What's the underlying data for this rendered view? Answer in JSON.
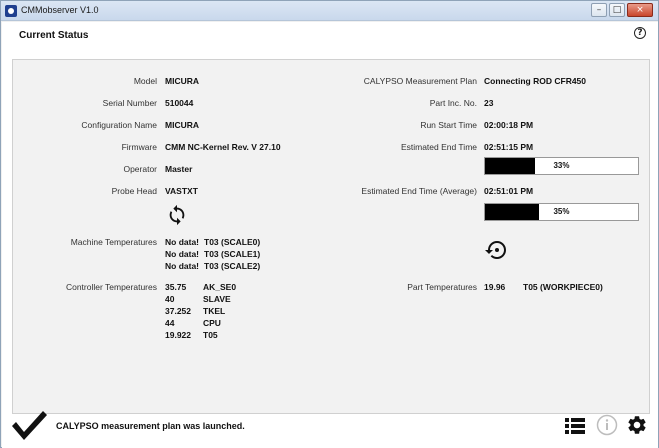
{
  "window": {
    "title": "CMMobserver V1.0",
    "minimize": "–",
    "maximize": "□",
    "close": "×"
  },
  "header": {
    "title": "Current Status",
    "help": "?"
  },
  "left": {
    "model": {
      "label": "Model",
      "value": "MICURA"
    },
    "serial": {
      "label": "Serial Number",
      "value": "510044"
    },
    "config": {
      "label": "Configuration Name",
      "value": "MICURA"
    },
    "firmware": {
      "label": "Firmware",
      "value": "CMM NC-Kernel Rev. V 27.10"
    },
    "operator": {
      "label": "Operator",
      "value": "Master"
    },
    "probe": {
      "label": "Probe Head",
      "value": "VASTXT"
    },
    "machine_temps": {
      "label": "Machine Temperatures",
      "rows": [
        {
          "value": "No data!",
          "sensor": "T03 (SCALE0)"
        },
        {
          "value": "No data!",
          "sensor": "T03 (SCALE1)"
        },
        {
          "value": "No data!",
          "sensor": "T03 (SCALE2)"
        }
      ]
    },
    "controller_temps": {
      "label": "Controller Temperatures",
      "rows": [
        {
          "value": "35.75",
          "sensor": "AK_SE0"
        },
        {
          "value": "40",
          "sensor": "SLAVE"
        },
        {
          "value": "37.252",
          "sensor": "TKEL"
        },
        {
          "value": "44",
          "sensor": "CPU"
        },
        {
          "value": "19.922",
          "sensor": "T05"
        }
      ]
    }
  },
  "right": {
    "plan": {
      "label": "CALYPSO Measurement Plan",
      "value": "Connecting ROD CFR450"
    },
    "part_inc": {
      "label": "Part Inc. No.",
      "value": "23"
    },
    "run_start": {
      "label": "Run Start Time",
      "value": "02:00:18 PM"
    },
    "est_end": {
      "label": "Estimated End Time",
      "value": "02:51:15 PM",
      "progress": 33,
      "progress_text": "33%"
    },
    "est_end_avg": {
      "label": "Estimated End Time (Average)",
      "value": "02:51:01 PM",
      "progress": 35,
      "progress_text": "35%"
    },
    "part_temps": {
      "label": "Part Temperatures",
      "value": "19.96",
      "sensor": "T05 (WORKPIECE0)"
    }
  },
  "status": {
    "message": "CALYPSO measurement plan was launched."
  },
  "icons": {
    "sync": "sync-icon",
    "restore": "restore-icon",
    "check": "check-icon",
    "list": "list-icon",
    "info": "info-icon",
    "gear": "gear-icon"
  }
}
